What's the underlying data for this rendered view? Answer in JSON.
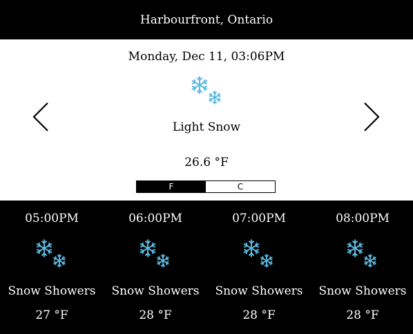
{
  "location": "Harbourfront, Ontario",
  "current": {
    "datetime": "Monday, Dec 11, 03:06PM",
    "condition": "Light Snow",
    "temperature": "26.6 °F",
    "icon": "snowflakes-icon"
  },
  "units": {
    "fahrenheit_label": "F",
    "celsius_label": "C",
    "selected": "F"
  },
  "navigation": {
    "prev_icon": "chevron-left-icon",
    "next_icon": "chevron-right-icon"
  },
  "forecast": [
    {
      "time": "05:00PM",
      "condition": "Snow Showers",
      "temperature": "27 °F",
      "icon": "snowflakes-icon"
    },
    {
      "time": "06:00PM",
      "condition": "Snow Showers",
      "temperature": "28 °F",
      "icon": "snowflakes-icon"
    },
    {
      "time": "07:00PM",
      "condition": "Snow Showers",
      "temperature": "28 °F",
      "icon": "snowflakes-icon"
    },
    {
      "time": "08:00PM",
      "condition": "Snow Showers",
      "temperature": "28 °F",
      "icon": "snowflakes-icon"
    }
  ],
  "colors": {
    "background": "#000000",
    "panel": "#ffffff",
    "snowflake": "#5bb8e0"
  }
}
